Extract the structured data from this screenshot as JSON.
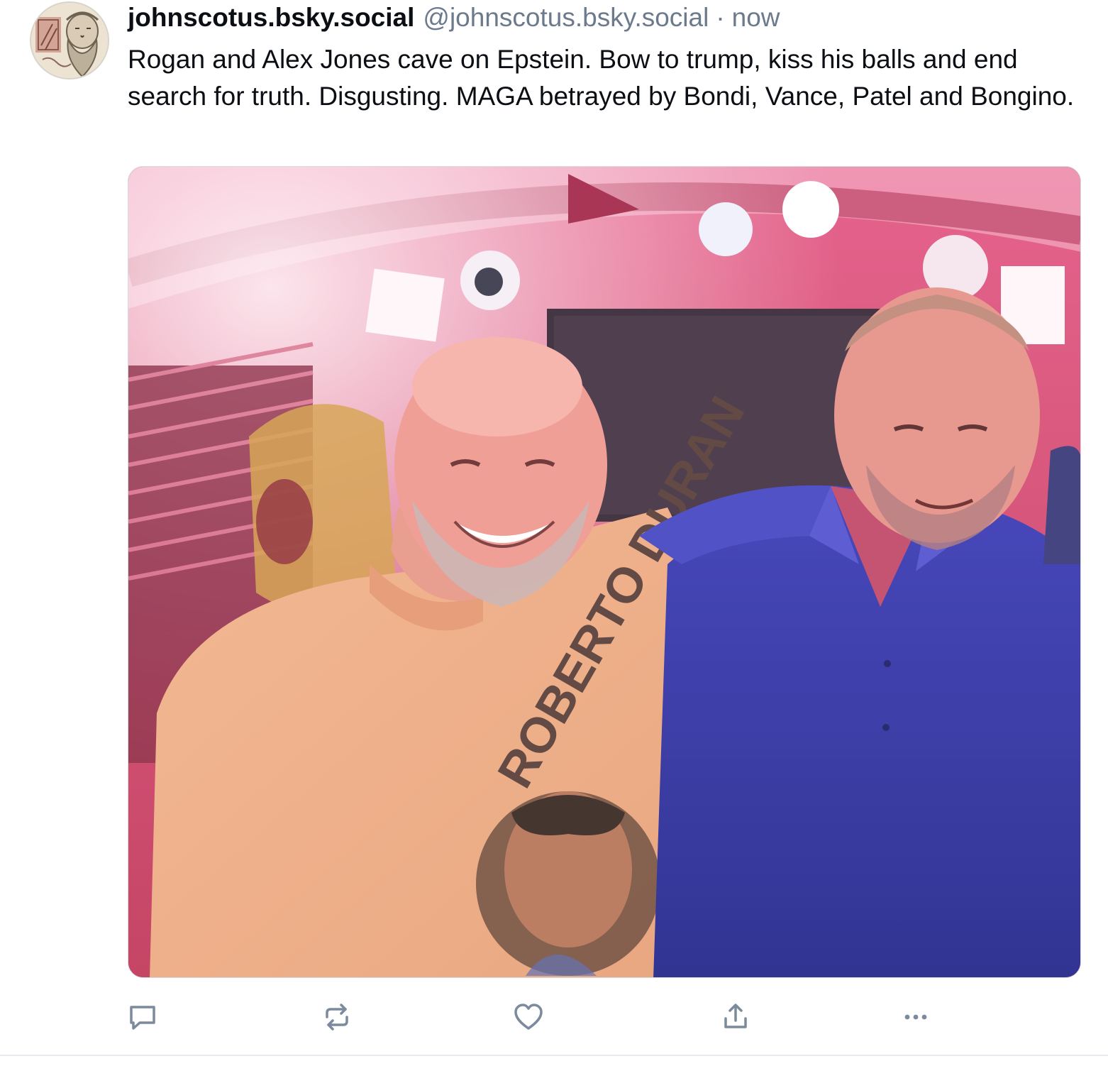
{
  "post": {
    "display_name": "johnscotus.bsky.social",
    "handle": "@johnscotus.bsky.social",
    "separator": "·",
    "timestamp": "now",
    "text": "Rogan and Alex Jones cave on Epstein. Bow to trump, kiss his balls and end search for truth. Disgusting. MAGA betrayed by Bondi, Vance, Patel and Bongino."
  },
  "media": {
    "shirt_text": "ROBERTO DURAN"
  },
  "actions": [
    {
      "name": "reply",
      "icon": "speech-bubble-icon"
    },
    {
      "name": "repost",
      "icon": "repost-arrows-icon"
    },
    {
      "name": "like",
      "icon": "heart-icon"
    },
    {
      "name": "share",
      "icon": "share-upload-icon"
    },
    {
      "name": "more",
      "icon": "ellipsis-icon"
    }
  ],
  "colors": {
    "text_primary": "#0b0f14",
    "text_secondary": "#6b7a8c",
    "icon": "#7b8a9c",
    "divider": "#e6e9ed"
  }
}
